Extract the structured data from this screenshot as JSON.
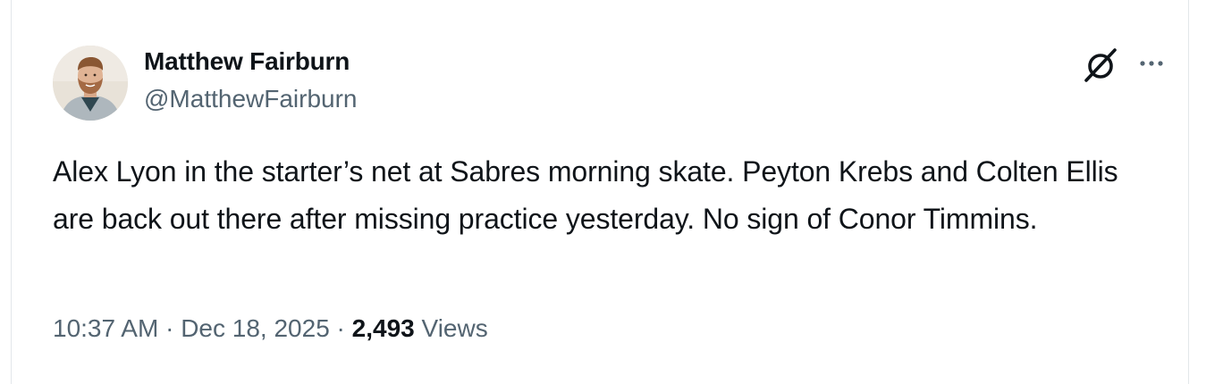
{
  "author": {
    "name": "Matthew Fairburn",
    "handle": "@MatthewFairburn"
  },
  "tweet": {
    "text": "Alex Lyon in the starter’s net at Sabres morning skate. Peyton Krebs and Colten Ellis are back out there after missing practice yesterday. No sign of Conor Timmins."
  },
  "meta": {
    "time": "10:37 AM",
    "separator1": " · ",
    "date": "Dec 18, 2025",
    "separator2": " · ",
    "views_count": "2,493",
    "views_label": " Views"
  },
  "icons": {
    "grok": "grok-icon",
    "more": "more-icon"
  },
  "colors": {
    "text_primary": "#0f1419",
    "text_secondary": "#536471",
    "border": "#e3e7ea"
  }
}
